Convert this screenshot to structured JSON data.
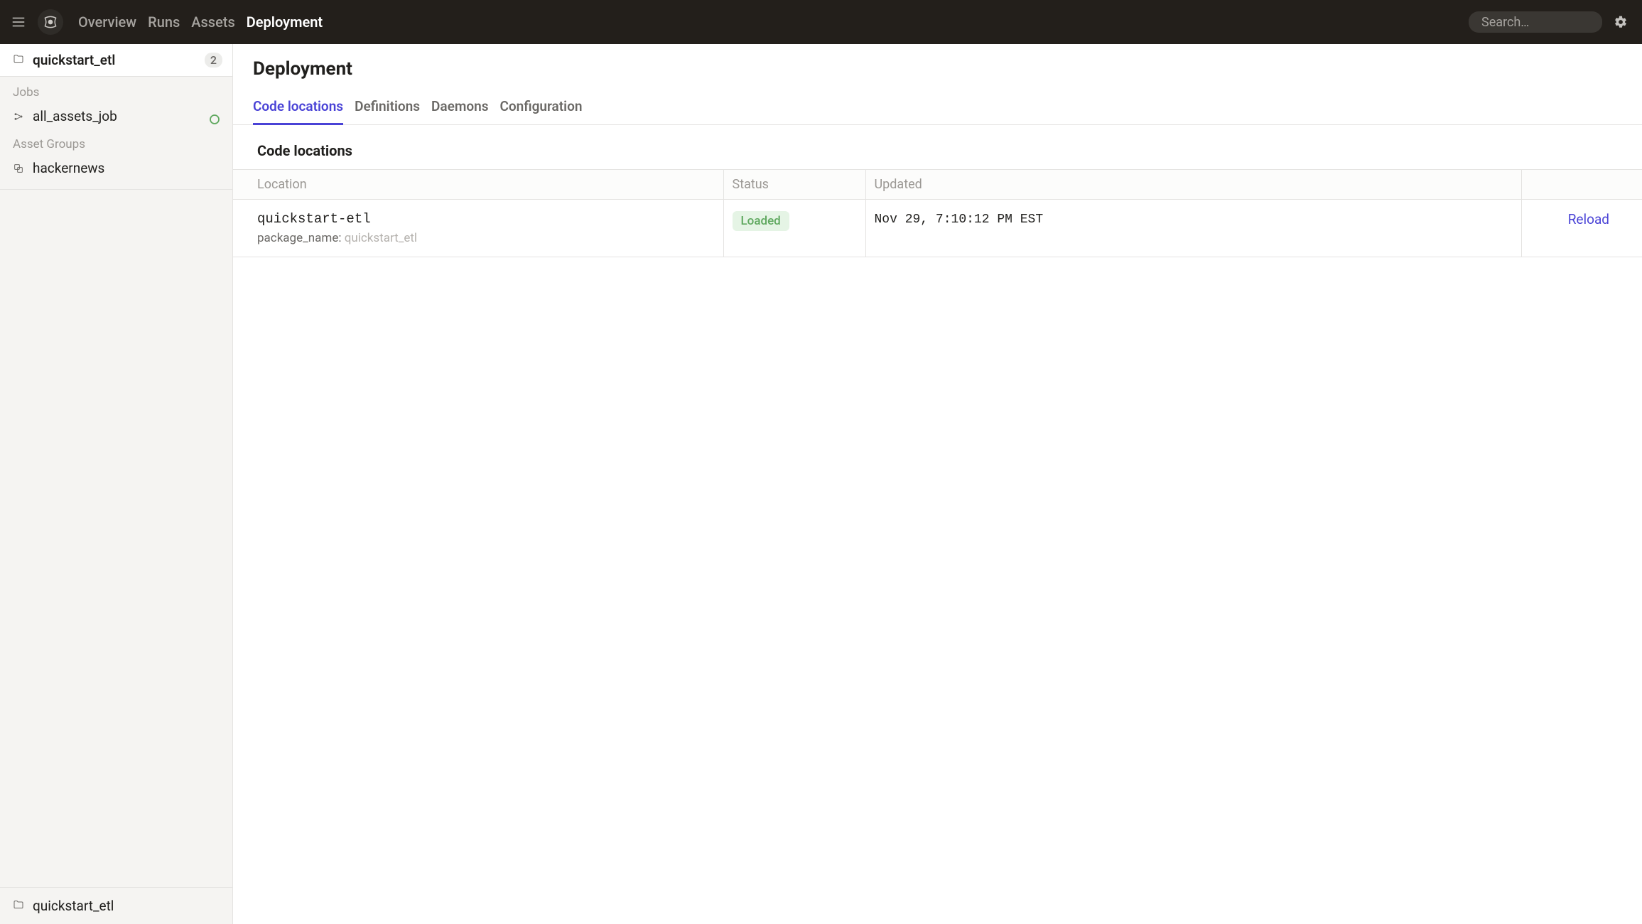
{
  "topbar": {
    "nav": [
      {
        "label": "Overview",
        "active": false
      },
      {
        "label": "Runs",
        "active": false
      },
      {
        "label": "Assets",
        "active": false
      },
      {
        "label": "Deployment",
        "active": true
      }
    ],
    "search_placeholder": "Search…",
    "search_kbd": "/"
  },
  "sidebar": {
    "project_name": "quickstart_etl",
    "project_count": "2",
    "sections": [
      {
        "label": "Jobs",
        "items": [
          {
            "icon": "job",
            "label": "all_assets_job",
            "status": "green"
          }
        ]
      },
      {
        "label": "Asset Groups",
        "items": [
          {
            "icon": "asset-group",
            "label": "hackernews"
          }
        ]
      }
    ],
    "footer_project": "quickstart_etl"
  },
  "main": {
    "title": "Deployment",
    "tabs": [
      {
        "label": "Code locations",
        "active": true
      },
      {
        "label": "Definitions",
        "active": false
      },
      {
        "label": "Daemons",
        "active": false
      },
      {
        "label": "Configuration",
        "active": false
      }
    ],
    "section_title": "Code locations",
    "table": {
      "headers": {
        "location": "Location",
        "status": "Status",
        "updated": "Updated"
      },
      "rows": [
        {
          "name": "quickstart-etl",
          "sub_label": "package_name:",
          "sub_value": "quickstart_etl",
          "status_label": "Loaded",
          "updated": "Nov 29, 7:10:12 PM EST",
          "action_label": "Reload"
        }
      ]
    }
  }
}
